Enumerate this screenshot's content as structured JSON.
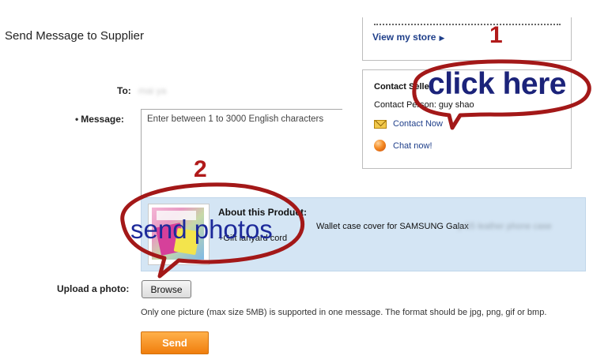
{
  "page": {
    "title": "Send Message to Supplier"
  },
  "store_panel": {
    "view_store_label": "View my store"
  },
  "contact_panel": {
    "heading": "Contact Seller",
    "contact_person_label": "Contact Person: guy shao",
    "contact_now_label": "Contact Now",
    "chat_now_label": "Chat now!"
  },
  "form": {
    "to_label": "To:",
    "to_value": "mai ya",
    "message_label": "Message:",
    "message_required_marker": "•",
    "message_placeholder": "Enter between 1 to 3000 English characters",
    "upload_label": "Upload a photo:",
    "browse_label": "Browse",
    "upload_hint": "Only one picture (max size 5MB) is supported in one message. The format should be jpg, png, gif or bmp.",
    "send_label": "Send"
  },
  "product": {
    "heading": "About this Product:",
    "title_visible": "Wallet case cover for SAMSUNG Galax",
    "title_blurred": "y S5 leather phone case",
    "title_line2": "+Gift lanyard cord"
  },
  "annotations": {
    "step1_number": "1",
    "step1_text": "click here",
    "step2_number": "2",
    "step2_text": "send photos",
    "color": "#b11a1a"
  }
}
